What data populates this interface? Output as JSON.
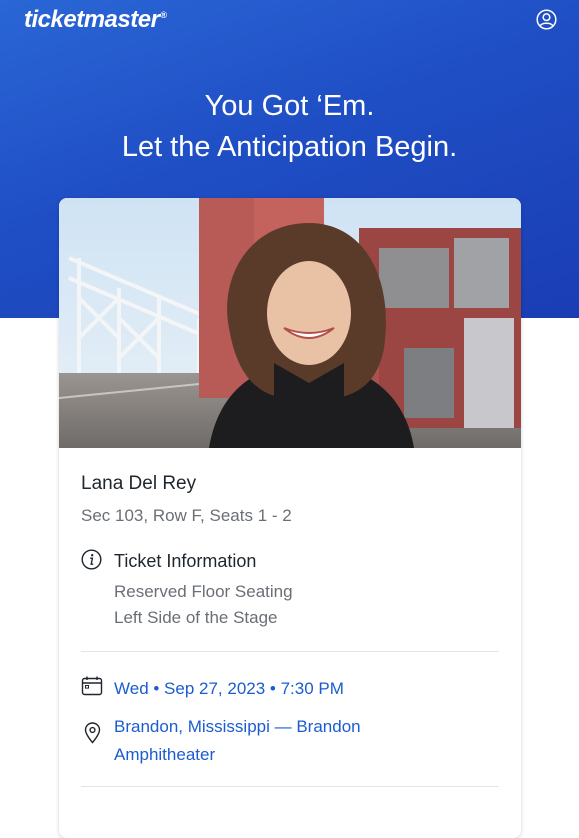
{
  "brand": {
    "logo_text": "ticketmaster",
    "logo_mark": "®"
  },
  "header": {
    "account_icon": "account-icon"
  },
  "hero": {
    "headline_line1": "You Got ‘Em.",
    "headline_line2": "Let the Anticipation Begin."
  },
  "event": {
    "artist": "Lana Del Rey",
    "seats": "Sec 103, Row F, Seats 1 - 2",
    "ticket_info_label": "Ticket Information",
    "ticket_info_line1": "Reserved Floor Seating",
    "ticket_info_line2": "Left Side of the Stage",
    "date_time": "Wed • Sep 27, 2023 • 7:30 PM",
    "venue": "Brandon, Mississippi — Brandon Amphitheater"
  },
  "colors": {
    "hero_blue": "#1f4ec4",
    "link_blue": "#1b5cd1",
    "text_dark": "#1f262d",
    "text_muted": "#6a6f76"
  }
}
